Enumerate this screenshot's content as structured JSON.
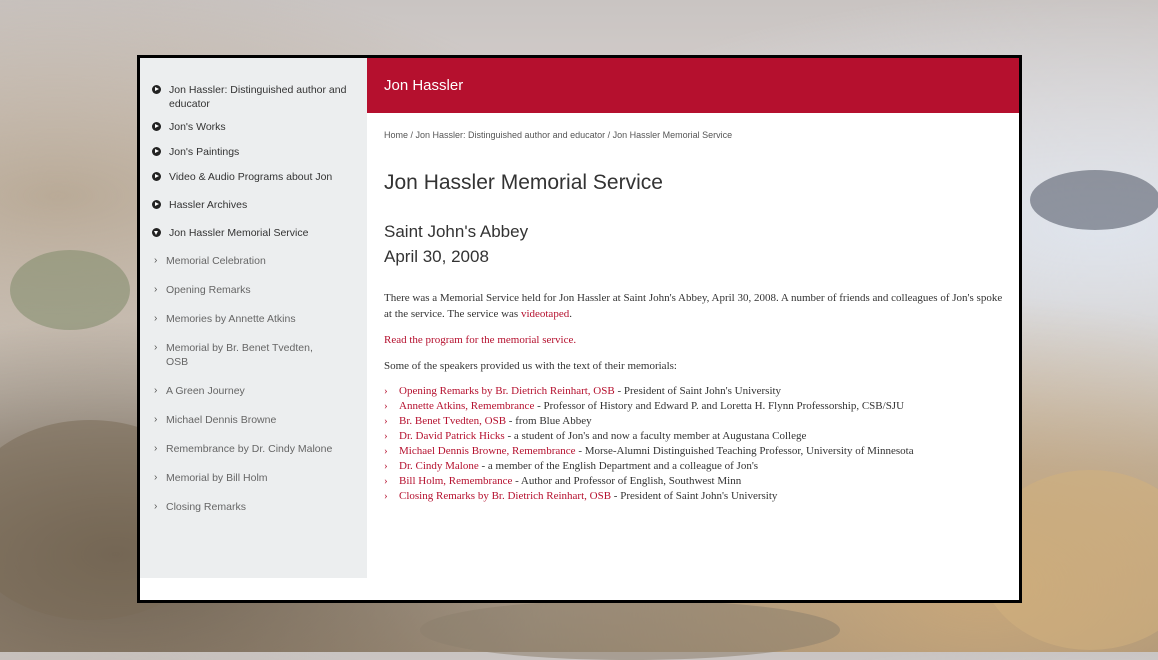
{
  "sidebar": {
    "items": [
      {
        "label": "Jon Hassler: Distinguished author and educator"
      },
      {
        "label": "Jon's Works"
      },
      {
        "label": "Jon's Paintings"
      },
      {
        "label": "Video & Audio Programs about Jon"
      },
      {
        "label": "Hassler Archives"
      },
      {
        "label": "Jon Hassler Memorial Service"
      }
    ],
    "subitems": [
      {
        "label": "Memorial Celebration"
      },
      {
        "label": "Opening Remarks"
      },
      {
        "label": "Memories by Annette Atkins"
      },
      {
        "label": "Memorial by Br. Benet Tvedten, OSB"
      },
      {
        "label": "A Green Journey"
      },
      {
        "label": "Michael Dennis Browne"
      },
      {
        "label": "Remembrance by Dr. Cindy Malone"
      },
      {
        "label": "Memorial by Bill Holm"
      },
      {
        "label": "Closing Remarks"
      }
    ]
  },
  "header": {
    "title": "Jon Hassler"
  },
  "breadcrumb": "Home / Jon Hassler: Distinguished author and educator / Jon Hassler Memorial Service",
  "page": {
    "title": "Jon Hassler Memorial Service",
    "subtitle_line1": "Saint John's Abbey",
    "subtitle_line2": "April 30, 2008",
    "intro_text": "There was a Memorial Service held for Jon Hassler at Saint John's Abbey, April 30, 2008. A number of friends and colleagues of Jon's spoke at the service. The service was ",
    "intro_link": "videotaped",
    "intro_end": ".",
    "program_link": "Read the program for the memorial service.",
    "speakers_intro": "Some of the speakers provided us with the text of their memorials:",
    "speakers": [
      {
        "link": "Opening Remarks by Br. Dietrich Reinhart, OSB",
        "desc": " - President of Saint John's University"
      },
      {
        "link": "Annette Atkins, Remembrance",
        "desc": " - Professor of History and Edward P. and Loretta H. Flynn Professorship, CSB/SJU"
      },
      {
        "link": "Br. Benet Tvedten, OSB",
        "desc": "  - from Blue Abbey"
      },
      {
        "link": "Dr. David Patrick Hicks",
        "desc": "  - a student of Jon's and now a faculty member at Augustana College"
      },
      {
        "link": "Michael Dennis Browne, Remembrance",
        "desc": " - Morse-Alumni Distinguished Teaching Professor, University of Minnesota"
      },
      {
        "link": "Dr. Cindy Malone",
        "desc": " - a member of the English Department and a colleague of Jon's"
      },
      {
        "link": "Bill Holm, Remembrance",
        "desc": " - Author and Professor of English, Southwest Minn"
      },
      {
        "link": "Closing Remarks by Br. Dietrich Reinhart, OSB",
        "desc": " - President of Saint John's University"
      }
    ]
  }
}
